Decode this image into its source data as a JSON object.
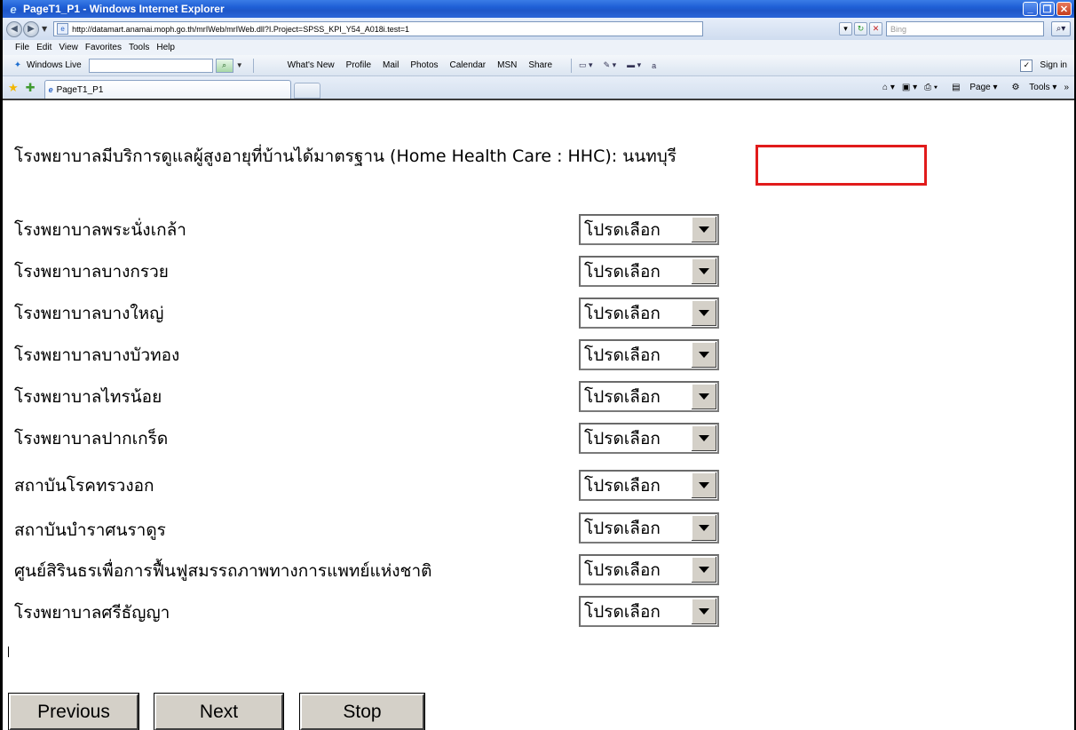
{
  "window": {
    "title": "PageT1_P1 - Windows Internet Explorer"
  },
  "address": {
    "url": "http://datamart.anamai.moph.go.th/mrIWeb/mrIWeb.dll?I.Project=SPSS_KPI_Y54_A018i.test=1",
    "search_placeholder": "Bing"
  },
  "menu": [
    "File",
    "Edit",
    "View",
    "Favorites",
    "Tools",
    "Help"
  ],
  "livebar": {
    "label": "Windows Live",
    "links": [
      "What's New",
      "Profile",
      "Mail",
      "Photos",
      "Calendar",
      "MSN",
      "Share"
    ],
    "sign_in": "Sign in"
  },
  "tabs": {
    "active_tab": "PageT1_P1",
    "page_label": "Page",
    "tools_label": "Tools"
  },
  "page": {
    "heading": "โรงพยาบาลมีบริการดูแลผู้สูงอายุที่บ้านได้มาตรฐาน (Home Health Care : HHC): นนทบุรี",
    "select_placeholder": "โปรดเลือก",
    "hospitals": [
      "โรงพยาบาลพระนั่งเกล้า",
      "โรงพยาบาลบางกรวย",
      "โรงพยาบาลบางใหญ่",
      "โรงพยาบาลบางบัวทอง",
      "โรงพยาบาลไทรน้อย",
      "โรงพยาบาลปากเกร็ด",
      "สถาบันโรคทรวงอก",
      "สถาบันบำราศนราดูร",
      "ศูนย์สิรินธรเพื่อการฟื้นฟูสมรรถภาพทางการแพทย์แห่งชาติ",
      "โรงพยาบาลศรีธัญญา"
    ],
    "buttons": {
      "previous": "Previous",
      "next": "Next",
      "stop": "Stop"
    }
  },
  "colors": {
    "highlight_border": "#e11b1b",
    "titlebar_blue": "#1f5fd6"
  }
}
